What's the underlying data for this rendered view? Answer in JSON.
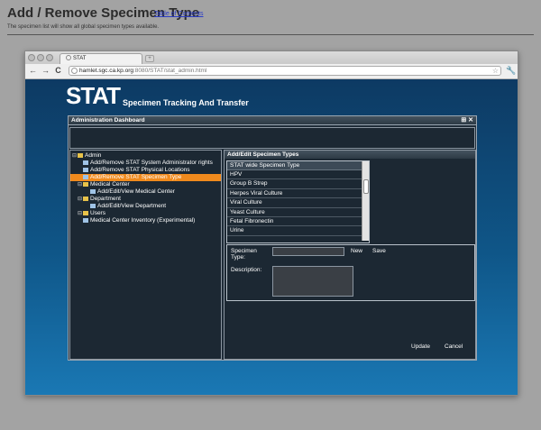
{
  "doc": {
    "title": "Add / Remove Specimen Type",
    "toc_link": "Table of Contents",
    "description": "The specimen list will show all global specimen types available."
  },
  "browser": {
    "tab_title": "STAT",
    "new_tab": "+",
    "url_host": "hamlet.sgc.ca.kp.org",
    "url_rest": ":8080/STAT/stat_admin.html",
    "back": "←",
    "forward": "→",
    "reload": "C",
    "star": "☆",
    "wrench": "🔧"
  },
  "app": {
    "logo": "STAT",
    "subtitle": "Specimen Tracking And Transfer"
  },
  "dashboard": {
    "title": "Administration Dashboard",
    "controls": "⊞ ✕"
  },
  "tree": [
    {
      "label": "Admin",
      "icon": "folder-icon",
      "pm": "⊟"
    },
    {
      "label": "Add/Remove STAT System Administrator rights",
      "icon": "page-icon"
    },
    {
      "label": "Add/Remove STAT Physical Locations",
      "icon": "page-icon"
    },
    {
      "label": "Add/Remove STAT Specimen Type",
      "icon": "page-icon",
      "selected": true
    },
    {
      "label": "Medical Center",
      "icon": "folder-icon",
      "pm": "⊟"
    },
    {
      "label": "Add/Edit/View Medical Center",
      "icon": "page-icon"
    },
    {
      "label": "Department",
      "icon": "folder-icon",
      "pm": "⊟"
    },
    {
      "label": "Add/Edit/View Department",
      "icon": "page-icon"
    },
    {
      "label": "Users",
      "icon": "folder-icon",
      "pm": "⊟"
    },
    {
      "label": "Medical Center Inventory (Experimental)",
      "icon": "page-icon"
    }
  ],
  "panel": {
    "title": "Add/Edit Specimen Types",
    "list_header": "STAT wide Specimen Type",
    "items": [
      "HPV",
      "Group B Strep",
      "Herpes Viral Culture",
      "Viral Culture",
      "Yeast Culture",
      "Fetal Fibronectin",
      "Urine"
    ],
    "specimen_type_label": "Specimen\nType:",
    "description_label": "Description:",
    "new_label": "New",
    "save_label": "Save",
    "update_label": "Update",
    "cancel_label": "Cancel"
  }
}
